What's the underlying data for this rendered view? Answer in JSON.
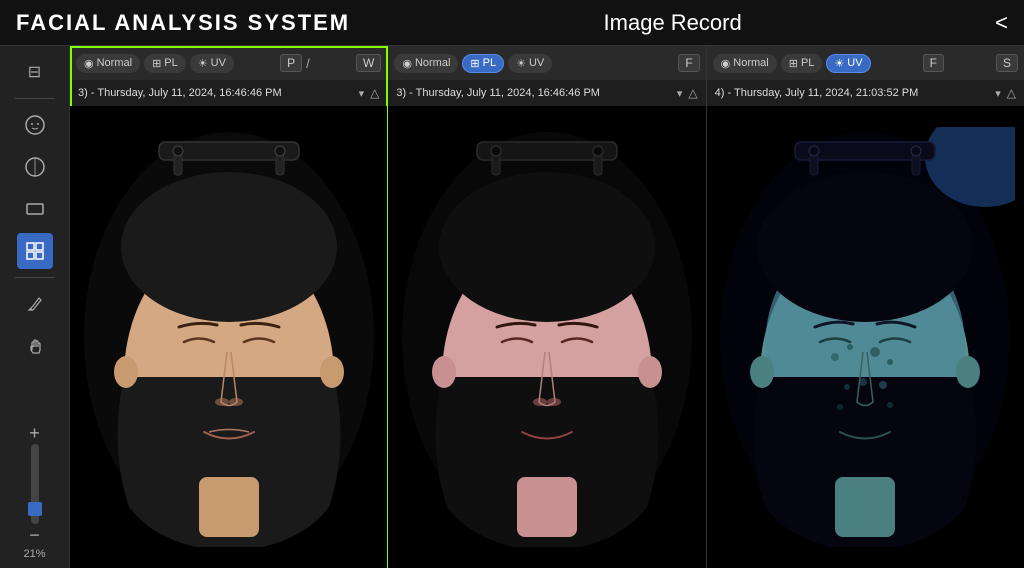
{
  "header": {
    "app_title": "FACIAL ANALYSIS SYSTEM",
    "page_title": "Image Record",
    "back_label": "<"
  },
  "sidebar": {
    "icons": [
      {
        "name": "layout-icon",
        "symbol": "⊞",
        "active": false
      },
      {
        "name": "face-icon",
        "symbol": "☺",
        "active": false
      },
      {
        "name": "face2-icon",
        "symbol": "☻",
        "active": false
      },
      {
        "name": "rect-icon",
        "symbol": "▭",
        "active": false
      },
      {
        "name": "grid-icon",
        "symbol": "⊞",
        "active": true
      },
      {
        "name": "pen-icon",
        "symbol": "✏",
        "active": false
      },
      {
        "name": "hand-icon",
        "symbol": "✋",
        "active": false
      }
    ],
    "zoom_plus": "+",
    "zoom_minus": "−",
    "zoom_percent": "21%"
  },
  "panels": [
    {
      "id": "panel-1",
      "selected": true,
      "modes": [
        {
          "label": "Normal",
          "icon": "◉",
          "active": false
        },
        {
          "label": "PL",
          "icon": "⊞",
          "active": false
        },
        {
          "label": "UV",
          "icon": "☀",
          "active": false
        }
      ],
      "composite_label": "P / W",
      "date": "3)  -  Thursday, July 11, 2024, 16:46:46 PM",
      "image_type": "normal",
      "letter_btns": [
        {
          "label": "P",
          "active": false
        },
        {
          "label": "W",
          "active": false
        }
      ]
    },
    {
      "id": "panel-2",
      "selected": false,
      "modes": [
        {
          "label": "Normal",
          "icon": "◉",
          "active": false
        },
        {
          "label": "PL",
          "icon": "⊞",
          "active": true
        },
        {
          "label": "UV",
          "icon": "☀",
          "active": false
        }
      ],
      "composite_label": "F",
      "date": "3)  -  Thursday, July 11, 2024, 16:46:46 PM",
      "image_type": "pl",
      "letter_btns": [
        {
          "label": "F",
          "active": false
        }
      ]
    },
    {
      "id": "panel-3",
      "selected": false,
      "modes": [
        {
          "label": "Normal",
          "icon": "◉",
          "active": false
        },
        {
          "label": "PL",
          "icon": "⊞",
          "active": false
        },
        {
          "label": "UV",
          "icon": "☀",
          "active": true
        }
      ],
      "composite_label": "F S",
      "date": "4)  -  Thursday, July 11, 2024, 21:03:52 PM",
      "image_type": "uv",
      "letter_btns": [
        {
          "label": "F",
          "active": false
        },
        {
          "label": "S",
          "active": false
        }
      ]
    }
  ]
}
